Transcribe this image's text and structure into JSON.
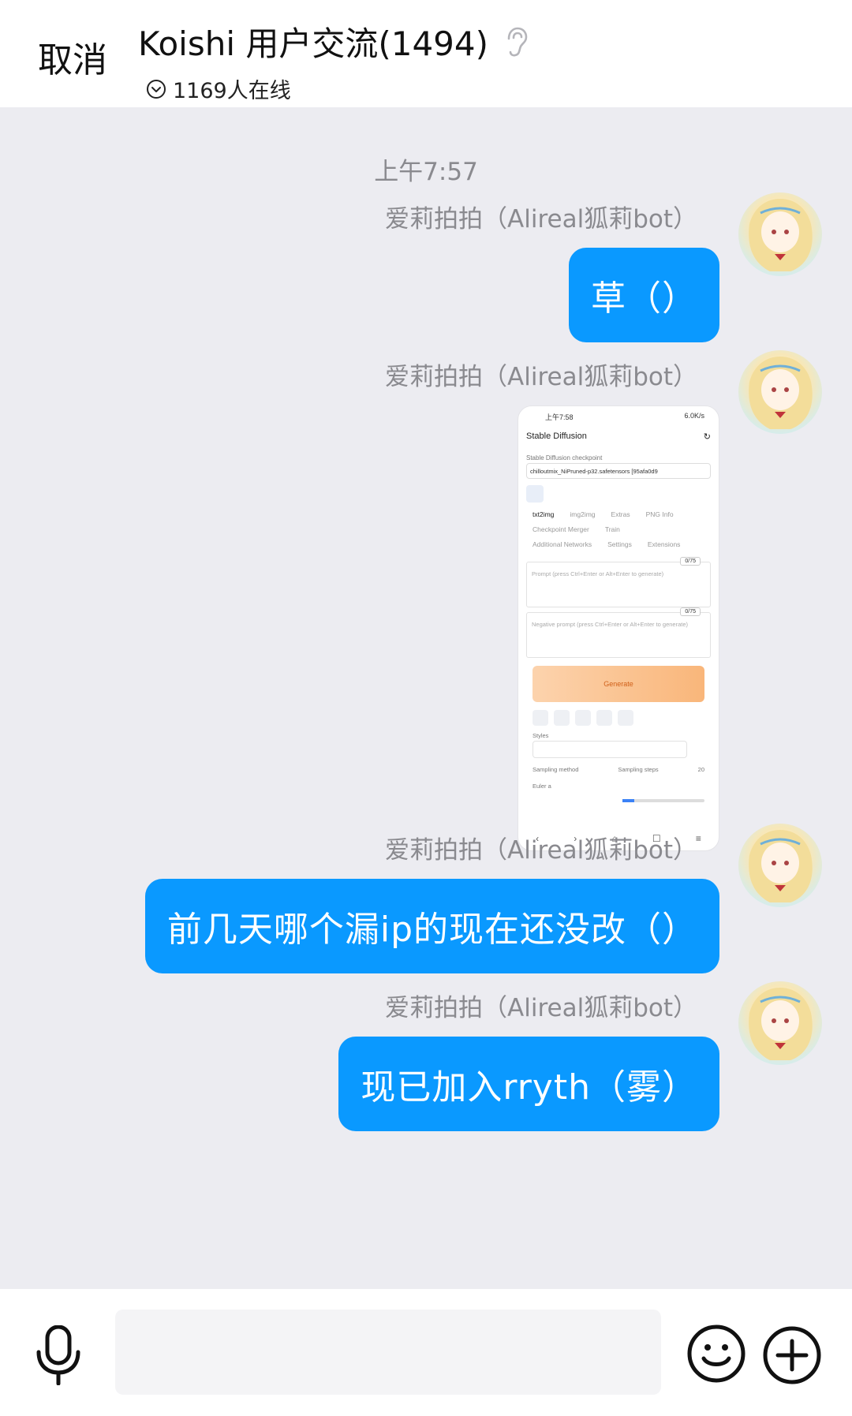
{
  "header": {
    "cancel_label": "取消",
    "title": "Koishi 用户交流(1494)",
    "online": "1169人在线"
  },
  "timestamp": "上午7:57",
  "messages": [
    {
      "sender": "爱莉拍拍（Alireal狐莉bot）",
      "text": "草（）"
    },
    {
      "sender": "爱莉拍拍（Alireal狐莉bot）",
      "image": {
        "status_time": "上午7:58",
        "status_right": "6.0K/s",
        "app_title": "Stable Diffusion",
        "checkpoint_label": "Stable Diffusion checkpoint",
        "checkpoint_value": "chilloutmix_NiPruned-p32.safetensors [95afa0d9",
        "tabs": [
          "txt2img",
          "img2img",
          "Extras",
          "PNG Info",
          "Checkpoint Merger",
          "Train",
          "Additional Networks",
          "Settings",
          "Extensions"
        ],
        "prompt_placeholder": "Prompt (press Ctrl+Enter or Alt+Enter to generate)",
        "negative_placeholder": "Negative prompt (press Ctrl+Enter or Alt+Enter to generate)",
        "token_count": "0/75",
        "generate_label": "Generate",
        "styles_label": "Styles",
        "sampling_method_label": "Sampling method",
        "sampling_method_value": "Euler a",
        "sampling_steps_label": "Sampling steps",
        "sampling_steps_value": "20"
      }
    },
    {
      "sender": "爱莉拍拍（Alireal狐莉bot）",
      "text": "前几天哪个漏ip的现在还没改（）"
    },
    {
      "sender": "爱莉拍拍（Alireal狐莉bot）",
      "text": "现已加入rryth（雾）"
    }
  ],
  "input": {
    "placeholder": ""
  },
  "colors": {
    "bubble": "#0a99ff",
    "background": "#ececf1",
    "header": "#ffffff"
  },
  "icons": [
    "ear-icon",
    "chevron-circle-icon",
    "microphone-icon",
    "emoji-icon",
    "plus-icon"
  ]
}
